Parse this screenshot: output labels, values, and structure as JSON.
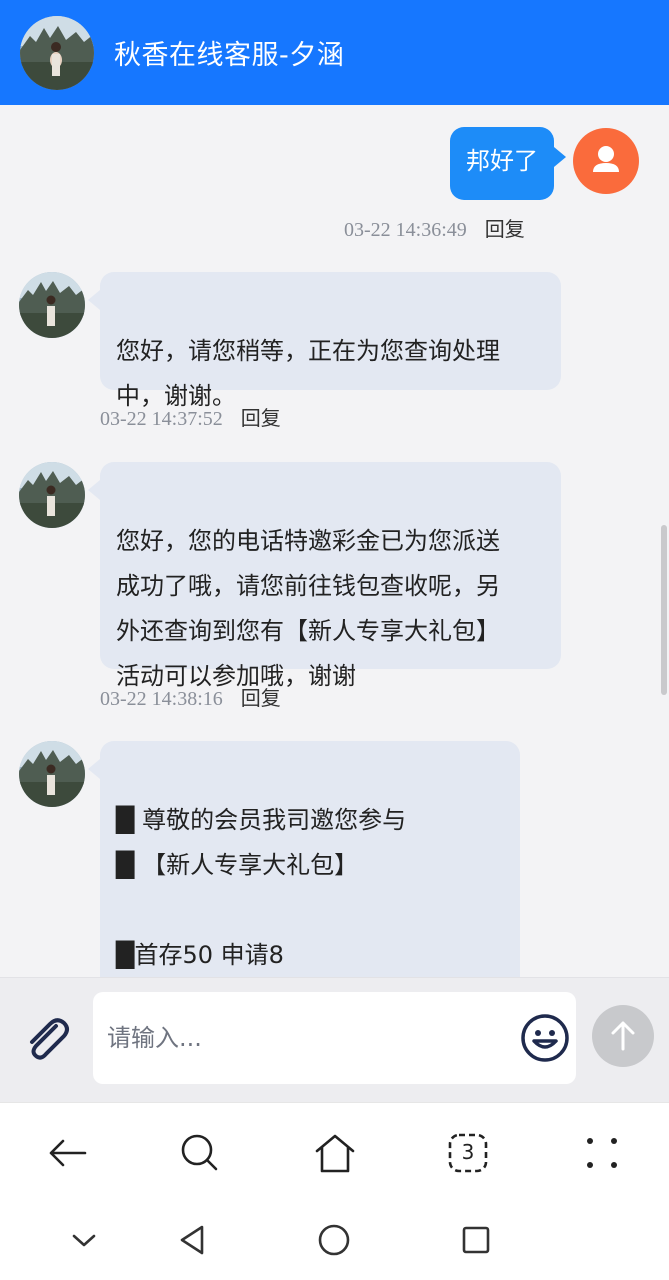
{
  "header": {
    "title": "秋香在线客服-夕涵"
  },
  "messages": [
    {
      "direction": "out",
      "text": "邦好了",
      "time": "03-22 14:36:49",
      "reply_label": "回复"
    },
    {
      "direction": "in",
      "text": "您好，请您稍等，正在为您查询处理\n中，谢谢。",
      "time": "03-22 14:37:52",
      "reply_label": "回复"
    },
    {
      "direction": "in",
      "text": "您好，您的电话特邀彩金已为您派送\n成功了哦，请您前往钱包查收呢，另\n外还查询到您有【新人专享大礼包】\n活动可以参加哦，谢谢",
      "time": "03-22 14:38:16",
      "reply_label": "回复"
    },
    {
      "direction": "in",
      "text": "█ 尊敬的会员我司邀您参与\n█ 【新人专享大礼包】\n\n█首存50 申请8"
    }
  ],
  "input": {
    "placeholder": "请输入..."
  },
  "icons": {
    "attach": "paperclip-icon",
    "emoji": "smile-icon",
    "send": "arrow-up-icon",
    "back": "arrow-left-icon",
    "search": "search-icon",
    "home": "home-icon",
    "tabs": "tabs-icon",
    "more": "dots-grid-icon"
  },
  "browser": {
    "tab_count": "3"
  },
  "colors": {
    "header_bg": "#1677ff",
    "outgoing_bubble": "#1d8cf8",
    "incoming_bubble": "#e3e8f2",
    "user_avatar": "#fa6b3c"
  }
}
